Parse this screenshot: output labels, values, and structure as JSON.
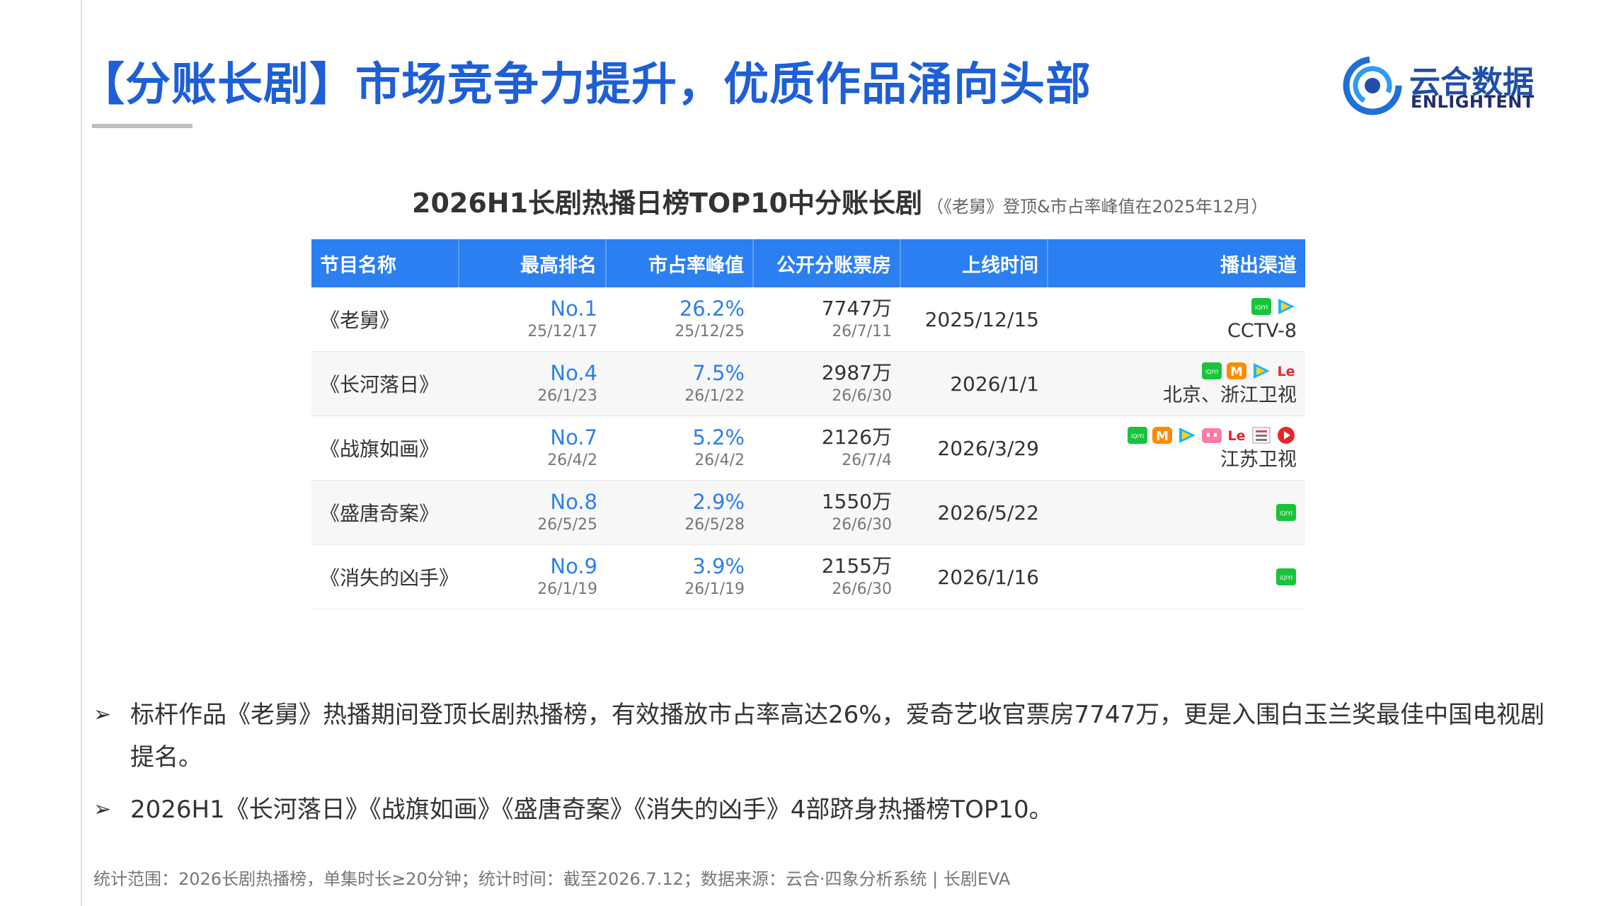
{
  "header": {
    "title": "【分账长剧】市场竞争力提升，优质作品涌向头部",
    "logo_cn": "云合数据",
    "logo_en": "ENLIGHTENT",
    "accent_color": "#1e5fd6"
  },
  "table_title": {
    "main": "2026H1长剧热播日榜TOP10中分账长剧",
    "sub": "（《老舅》登顶&市占率峰值在2025年12月）"
  },
  "columns": [
    "节目名称",
    "最高排名",
    "市占率峰值",
    "公开分账票房",
    "上线时间",
    "播出渠道"
  ],
  "rows": [
    {
      "name": "《老舅》",
      "rank": "No.1",
      "rank_date": "25/12/17",
      "share": "26.2%",
      "share_date": "25/12/25",
      "box": "7747万",
      "box_date": "26/7/11",
      "launch": "2025/12/15",
      "channels": [
        "iqiyi-icon",
        "tencent-video-icon"
      ],
      "channel_text": "CCTV-8"
    },
    {
      "name": "《长河落日》",
      "rank": "No.4",
      "rank_date": "26/1/23",
      "share": "7.5%",
      "share_date": "26/1/22",
      "box": "2987万",
      "box_date": "26/6/30",
      "launch": "2026/1/1",
      "channels": [
        "iqiyi-icon",
        "mango-tv-icon",
        "tencent-video-icon",
        "letv-icon"
      ],
      "channel_text": "北京、浙江卫视"
    },
    {
      "name": "《战旗如画》",
      "rank": "No.7",
      "rank_date": "26/4/2",
      "share": "5.2%",
      "share_date": "26/4/2",
      "box": "2126万",
      "box_date": "26/7/4",
      "launch": "2026/3/29",
      "channels": [
        "iqiyi-icon",
        "mango-tv-icon",
        "tencent-video-icon",
        "bilibili-icon",
        "letv-icon",
        "sohu-video-icon",
        "youku-icon"
      ],
      "channel_text": "江苏卫视"
    },
    {
      "name": "《盛唐奇案》",
      "rank": "No.8",
      "rank_date": "26/5/25",
      "share": "2.9%",
      "share_date": "26/5/28",
      "box": "1550万",
      "box_date": "26/6/30",
      "launch": "2026/5/22",
      "channels": [
        "iqiyi-icon"
      ],
      "channel_text": ""
    },
    {
      "name": "《消失的凶手》",
      "rank": "No.9",
      "rank_date": "26/1/19",
      "share": "3.9%",
      "share_date": "26/1/19",
      "box": "2155万",
      "box_date": "26/6/30",
      "launch": "2026/1/16",
      "channels": [
        "iqiyi-icon"
      ],
      "channel_text": ""
    }
  ],
  "bullets": [
    "标杆作品《老舅》热播期间登顶长剧热播榜，有效播放市占率高达26%，爱奇艺收官票房7747万，更是入围白玉兰奖最佳中国电视剧提名。",
    "2026H1《长河落日》《战旗如画》《盛唐奇案》《消失的凶手》4部跻身热播榜TOP10。"
  ],
  "bullet_marker": "➢",
  "footnote": "统计范围：2026长剧热播榜，单集时长≥20分钟；统计时间：截至2026.7.12；数据来源：云合·四象分析系统 | 长剧EVA",
  "colors": {
    "header_blue": "#2b7ff0",
    "value_blue": "#2b7ff0",
    "title_blue": "#1e5fd6"
  }
}
